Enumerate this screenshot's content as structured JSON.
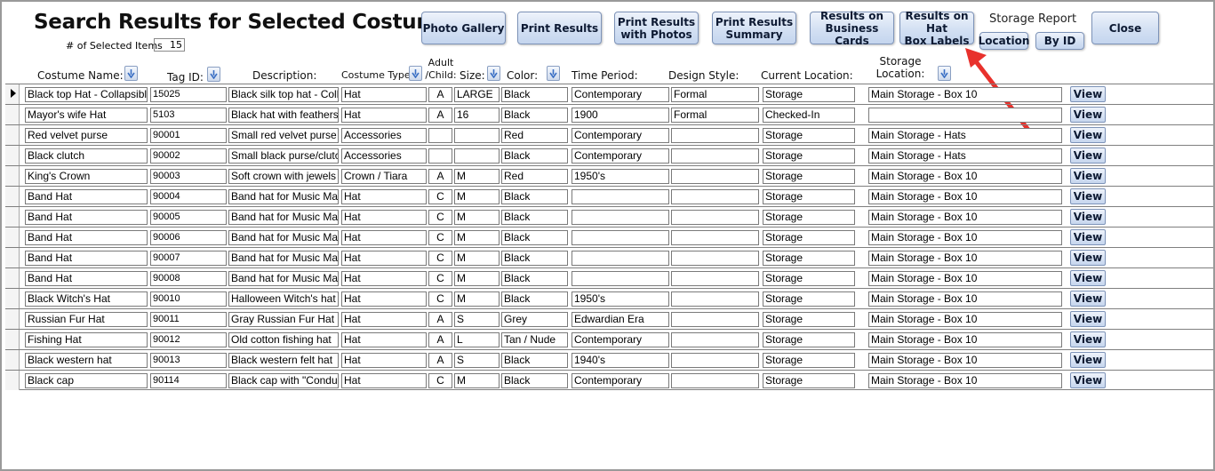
{
  "title": "Search Results for Selected Costumes",
  "selected_count_label": "# of Selected Items",
  "selected_count": "15",
  "buttons": {
    "photo_gallery": "Photo Gallery",
    "print_results": "Print Results",
    "print_results_photos": "Print Results\nwith Photos",
    "print_results_summary": "Print Results\nSummary",
    "results_business_cards": "Results on\nBusiness Cards",
    "results_hat_box_labels": "Results on Hat\nBox Labels",
    "storage_report_label": "Storage Report",
    "location": "Location",
    "by_id": "By ID",
    "close": "Close"
  },
  "columns": {
    "costume_name": "Costume Name:",
    "tag_id": "Tag ID:",
    "description": "Description:",
    "costume_type": "Costume Type:",
    "adult_child": "Adult\n/Child:",
    "size": "Size:",
    "color": "Color:",
    "time_period": "Time Period:",
    "design_style": "Design Style:",
    "current_location": "Current Location:",
    "storage_location": "Storage\nLocation:"
  },
  "view_label": "View",
  "rows": [
    {
      "name": "Black top Hat - Collapsibl",
      "tag": "15025",
      "desc": "Black silk top hat - Coll",
      "type": "Hat",
      "ac": "A",
      "size": "LARGE",
      "color": "Black",
      "period": "Contemporary",
      "style": "Formal",
      "current": "Storage",
      "storage": "Main Storage - Box 10"
    },
    {
      "name": "Mayor's wife Hat",
      "tag": "5103",
      "desc": "Black hat with feathers",
      "type": "Hat",
      "ac": "A",
      "size": "16",
      "color": "Black",
      "period": "1900",
      "style": "Formal",
      "current": "Checked-In",
      "storage": ""
    },
    {
      "name": "Red velvet purse",
      "tag": "90001",
      "desc": "Small red velvet purse",
      "type": "Accessories",
      "ac": "",
      "size": "",
      "color": "Red",
      "period": "Contemporary",
      "style": "",
      "current": "Storage",
      "storage": "Main Storage - Hats"
    },
    {
      "name": "Black clutch",
      "tag": "90002",
      "desc": "Small black purse/clutc",
      "type": "Accessories",
      "ac": "",
      "size": "",
      "color": "Black",
      "period": "Contemporary",
      "style": "",
      "current": "Storage",
      "storage": "Main Storage - Hats"
    },
    {
      "name": "King's Crown",
      "tag": "90003",
      "desc": "Soft crown with jewels",
      "type": "Crown / Tiara",
      "ac": "A",
      "size": "M",
      "color": "Red",
      "period": "1950's",
      "style": "",
      "current": "Storage",
      "storage": "Main Storage - Box 10"
    },
    {
      "name": "Band Hat",
      "tag": "90004",
      "desc": "Band hat for Music Ma",
      "type": "Hat",
      "ac": "C",
      "size": "M",
      "color": "Black",
      "period": "",
      "style": "",
      "current": "Storage",
      "storage": "Main Storage - Box 10"
    },
    {
      "name": "Band Hat",
      "tag": "90005",
      "desc": "Band hat for Music Ma",
      "type": "Hat",
      "ac": "C",
      "size": "M",
      "color": "Black",
      "period": "",
      "style": "",
      "current": "Storage",
      "storage": "Main Storage - Box 10"
    },
    {
      "name": "Band Hat",
      "tag": "90006",
      "desc": "Band hat for Music Ma",
      "type": "Hat",
      "ac": "C",
      "size": "M",
      "color": "Black",
      "period": "",
      "style": "",
      "current": "Storage",
      "storage": "Main Storage - Box 10"
    },
    {
      "name": "Band Hat",
      "tag": "90007",
      "desc": "Band hat for Music Ma",
      "type": "Hat",
      "ac": "C",
      "size": "M",
      "color": "Black",
      "period": "",
      "style": "",
      "current": "Storage",
      "storage": "Main Storage - Box 10"
    },
    {
      "name": "Band Hat",
      "tag": "90008",
      "desc": "Band hat for Music Ma",
      "type": "Hat",
      "ac": "C",
      "size": "M",
      "color": "Black",
      "period": "",
      "style": "",
      "current": "Storage",
      "storage": "Main Storage - Box 10"
    },
    {
      "name": "Black Witch's Hat",
      "tag": "90010",
      "desc": "Halloween Witch's hat",
      "type": "Hat",
      "ac": "C",
      "size": "M",
      "color": "Black",
      "period": "1950's",
      "style": "",
      "current": "Storage",
      "storage": "Main Storage - Box 10"
    },
    {
      "name": "Russian Fur Hat",
      "tag": "90011",
      "desc": "Gray Russian Fur Hat",
      "type": "Hat",
      "ac": "A",
      "size": "S",
      "color": "Grey",
      "period": "Edwardian Era",
      "style": "",
      "current": "Storage",
      "storage": "Main Storage - Box 10"
    },
    {
      "name": "Fishing Hat",
      "tag": "90012",
      "desc": "Old cotton fishing hat",
      "type": "Hat",
      "ac": "A",
      "size": "L",
      "color": "Tan / Nude",
      "period": "Contemporary",
      "style": "",
      "current": "Storage",
      "storage": "Main Storage - Box 10"
    },
    {
      "name": "Black western hat",
      "tag": "90013",
      "desc": "Black western felt hat",
      "type": "Hat",
      "ac": "A",
      "size": "S",
      "color": "Black",
      "period": "1940's",
      "style": "",
      "current": "Storage",
      "storage": "Main Storage - Box 10"
    },
    {
      "name": "Black cap",
      "tag": "90114",
      "desc": "Black cap with \"Condu",
      "type": "Hat",
      "ac": "C",
      "size": "M",
      "color": "Black",
      "period": "Contemporary",
      "style": "",
      "current": "Storage",
      "storage": "Main Storage - Box 10"
    }
  ],
  "colors": {
    "button_border": "#7d93b8",
    "arrow": "#e8312c"
  },
  "icons": {
    "sort": "sort-down-arrow-icon",
    "record_pointer": "record-pointer-icon",
    "annotation": "red-arrow-icon"
  }
}
